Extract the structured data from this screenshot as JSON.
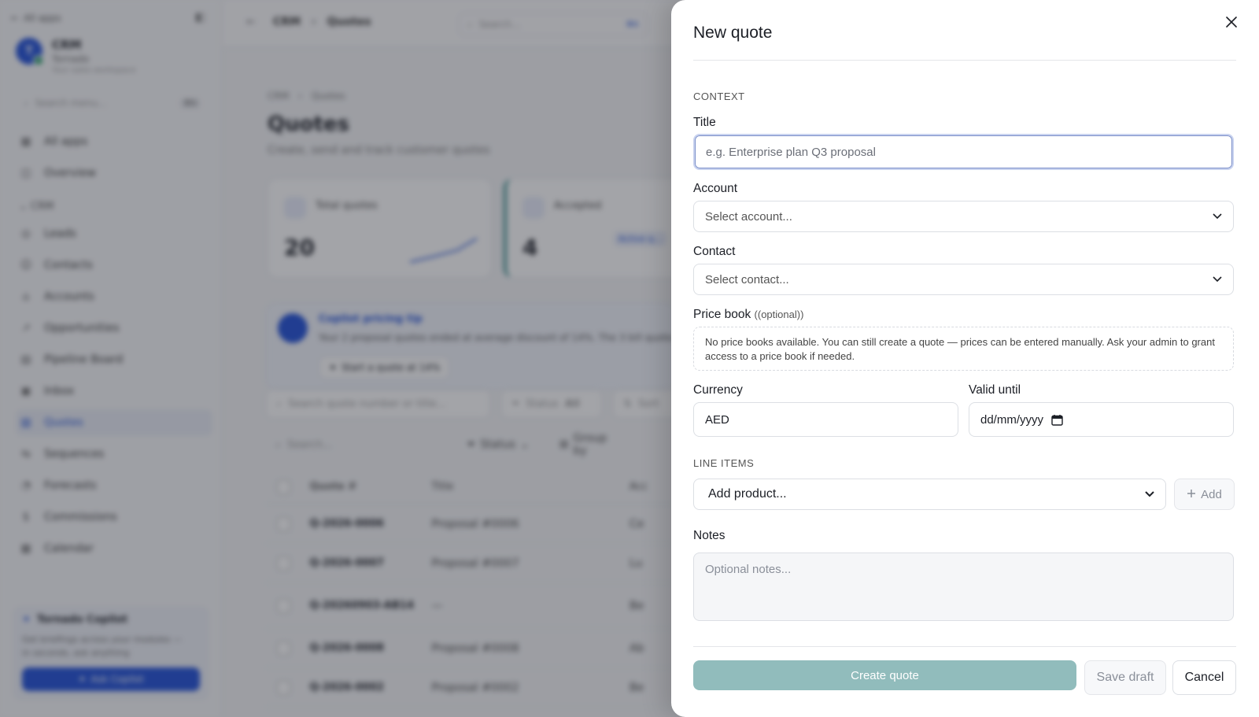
{
  "background": {
    "sidebar": {
      "back_label": "All apps",
      "workspace": {
        "initial": "T",
        "name": "CRM",
        "subtitle": "Tornado",
        "meta": "Your sales workspace"
      },
      "search_placeholder": "Search menu...",
      "search_shortcut": "⌘K",
      "items_top": [
        {
          "icon": "▦",
          "label": "All apps"
        },
        {
          "icon": "◫",
          "label": "Overview"
        }
      ],
      "group_label": "CRM",
      "items": [
        {
          "icon": "◎",
          "label": "Leads"
        },
        {
          "icon": "☺",
          "label": "Contacts"
        },
        {
          "icon": "⌂",
          "label": "Accounts"
        },
        {
          "icon": "↗",
          "label": "Opportunities"
        },
        {
          "icon": "▤",
          "label": "Pipeline Board"
        },
        {
          "icon": "▣",
          "label": "Inbox"
        },
        {
          "icon": "▧",
          "label": "Quotes"
        },
        {
          "icon": "⇆",
          "label": "Sequences"
        },
        {
          "icon": "◔",
          "label": "Forecasts"
        },
        {
          "icon": "$",
          "label": "Commissions"
        },
        {
          "icon": "▦",
          "label": "Calendar"
        }
      ],
      "copilot": {
        "title": "Tornado Copilot",
        "text": "Get briefings across your modules — in seconds, ask anything",
        "button": "Ask Copilot"
      }
    },
    "topbar": {
      "crumb_root": "CRM",
      "crumb_page": "Quotes",
      "search_placeholder": "Search...",
      "search_shortcut": "⌘K"
    },
    "page": {
      "crumb_root": "CRM",
      "crumb_page": "Quotes",
      "title": "Quotes",
      "subtitle": "Create, send and track customer quotes",
      "stat1": {
        "label": "Total quotes",
        "value": "20"
      },
      "stat2": {
        "label": "Accepted",
        "value": "4",
        "tag": "Active q..."
      },
      "insight": {
        "title": "Copilot pricing tip",
        "text": "Your 2 proposal quotes ended at average discount of 14%. The 3 bill quote...",
        "button": "Start a quote at 14%"
      },
      "filter1": {
        "search": "Search quote number or title...",
        "status": "Status",
        "status_value": "All",
        "sort": "Sort"
      },
      "filter2": {
        "search": "Search...",
        "status": "Status",
        "group": "Group by"
      },
      "table": {
        "headers": {
          "number": "Quote #",
          "title": "Title",
          "account": "Acc"
        },
        "rows": [
          {
            "number": "Q-2026-0006",
            "title": "Proposal #0006",
            "account": "Ce"
          },
          {
            "number": "Q-2026-0007",
            "title": "Proposal #0007",
            "account": "Lu"
          },
          {
            "number": "Q-20260903-AB14",
            "title": "—",
            "account": "Be"
          },
          {
            "number": "Q-2026-0008",
            "title": "Proposal #0008",
            "account": "Ab"
          },
          {
            "number": "Q-2026-0002",
            "title": "Proposal #0002",
            "account": "Be"
          }
        ]
      }
    }
  },
  "drawer": {
    "title": "New quote",
    "section_context": "CONTEXT",
    "title_label": "Title",
    "title_placeholder": "e.g. Enterprise plan Q3 proposal",
    "account_label": "Account",
    "account_placeholder": "Select account...",
    "contact_label": "Contact",
    "contact_placeholder": "Select contact...",
    "price_book_label": "Price book",
    "price_book_optional": "((optional))",
    "price_book_notice": "No price books available. You can still create a quote — prices can be entered manually. Ask your admin to grant access to a price book if needed.",
    "currency_label": "Currency",
    "currency_value": "AED",
    "valid_until_label": "Valid until",
    "valid_until_placeholder": "dd/mm/yyyy",
    "section_line_items": "LINE ITEMS",
    "add_product_placeholder": "Add product...",
    "add_button": "Add",
    "notes_label": "Notes",
    "notes_placeholder": "Optional notes...",
    "create_button": "Create quote",
    "save_draft_button": "Save draft",
    "cancel_button": "Cancel"
  }
}
